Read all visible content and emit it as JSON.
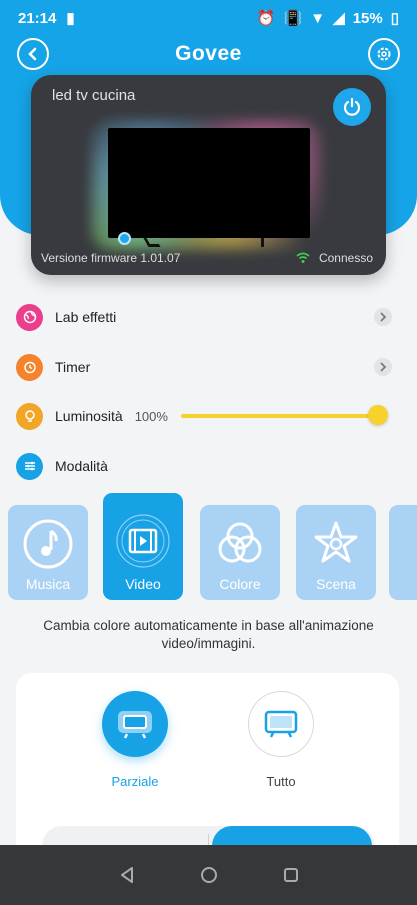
{
  "status_bar": {
    "time": "21:14",
    "battery": "15%"
  },
  "header": {
    "logo": "Govee"
  },
  "device": {
    "name": "led tv cucina",
    "firmware": "Versione firmware 1.01.07",
    "connection_status": "Connesso"
  },
  "menu": {
    "lab_effects": "Lab effetti",
    "timer": "Timer",
    "brightness": "Luminosità",
    "brightness_value": "100%",
    "brightness_level": 1.0,
    "mode": "Modalità"
  },
  "modes": [
    {
      "label": "Musica",
      "icon": "music-note-icon"
    },
    {
      "label": "Video",
      "icon": "video-film-icon",
      "active": true
    },
    {
      "label": "Colore",
      "icon": "color-circles-icon"
    },
    {
      "label": "Scena",
      "icon": "scene-star-icon"
    }
  ],
  "description": "Cambia colore automaticamente in base all'animazione video/immagini.",
  "video_modes": [
    {
      "label": "Parziale",
      "active": true
    },
    {
      "label": "Tutto",
      "active": false
    }
  ],
  "colors": {
    "primary": "#17a2e6",
    "slider": "#f7d22c",
    "lab_icon": "#ec3e8c",
    "timer_icon": "#f5832b",
    "brightness_icon": "#f1a628"
  }
}
